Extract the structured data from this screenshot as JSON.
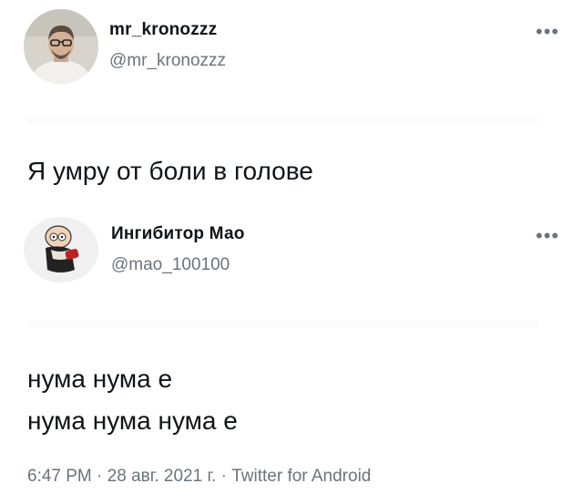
{
  "tweet1": {
    "display_name": "mr_kronozzz",
    "handle": "@mr_kronozzz",
    "text": "Я умру от боли в голове",
    "more_icon": "more-horizontal-icon"
  },
  "tweet2": {
    "display_name": "Ингибитор Мао",
    "handle": "@mao_100100",
    "lines": [
      "нума нума е",
      "нума нума нума е"
    ],
    "more_icon": "more-horizontal-icon"
  },
  "footer": {
    "time": "6:47 PM",
    "date": "28 авг. 2021 г.",
    "source": "Twitter for Android",
    "separator": "·"
  },
  "colors": {
    "text_primary": "#0f1419",
    "text_secondary": "#6b747c",
    "background": "#ffffff"
  }
}
